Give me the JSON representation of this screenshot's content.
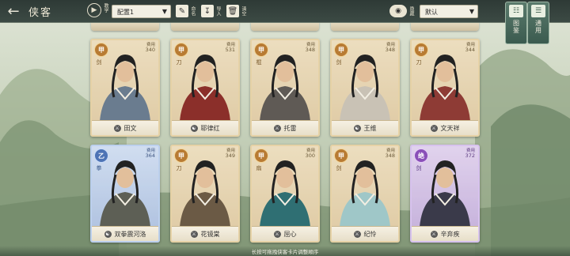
{
  "header": {
    "back_icon": "arrow-left-icon",
    "title": "侠客",
    "tutorial_label": "教学",
    "config_value": "配置1",
    "tools": [
      {
        "icon": "brush-icon",
        "label": "命名"
      },
      {
        "icon": "import-icon",
        "label": "导入"
      },
      {
        "icon": "trash-icon",
        "label": "清空"
      }
    ],
    "visibility_label": "隐藏",
    "sort_value": "默认"
  },
  "side": [
    {
      "icon": "book-icon",
      "label": "图鉴"
    },
    {
      "icon": "scroll-icon",
      "label": "通用"
    }
  ],
  "cards": [
    {
      "grade": "甲",
      "cost_label": "费用",
      "cost": "340",
      "name": "田文",
      "sect_icon": "sword-icon",
      "weapon": "剑"
    },
    {
      "grade": "甲",
      "cost_label": "费用",
      "cost": "531",
      "name": "耶律红",
      "sect_icon": "yin-yang-icon",
      "weapon": "刀"
    },
    {
      "grade": "甲",
      "cost_label": "费用",
      "cost": "348",
      "name": "托雷",
      "sect_icon": "sword-icon",
      "weapon": "棍"
    },
    {
      "grade": "甲",
      "cost_label": "费用",
      "cost": "348",
      "name": "王维",
      "sect_icon": "yin-yang-icon",
      "weapon": "剑"
    },
    {
      "grade": "甲",
      "cost_label": "费用",
      "cost": "344",
      "name": "文天祥",
      "sect_icon": "sword-icon",
      "weapon": "刀"
    },
    {
      "grade": "乙",
      "cost_label": "费用",
      "cost": "364",
      "name": "双拳震河洛",
      "sect_icon": "yin-yang-icon",
      "weapon": "拳"
    },
    {
      "grade": "甲",
      "cost_label": "费用",
      "cost": "349",
      "name": "花镜棠",
      "sect_icon": "sword-icon",
      "weapon": "刀"
    },
    {
      "grade": "甲",
      "cost_label": "费用",
      "cost": "300",
      "name": "屈心",
      "sect_icon": "sword-icon",
      "weapon": "扇"
    },
    {
      "grade": "甲",
      "cost_label": "费用",
      "cost": "348",
      "name": "纪怜",
      "sect_icon": "sword-icon",
      "weapon": "剑"
    },
    {
      "grade": "绝",
      "cost_label": "费用",
      "cost": "372",
      "name": "辛弃疾",
      "sect_icon": "sword-icon",
      "weapon": "剑"
    }
  ],
  "footer": "长按可拖拽侠客卡片调整顺序",
  "colors": {
    "jia": "#b87b33",
    "yi": "#4d73b5",
    "jue": "#8a4fb8",
    "topbar": "#2e3a36"
  }
}
